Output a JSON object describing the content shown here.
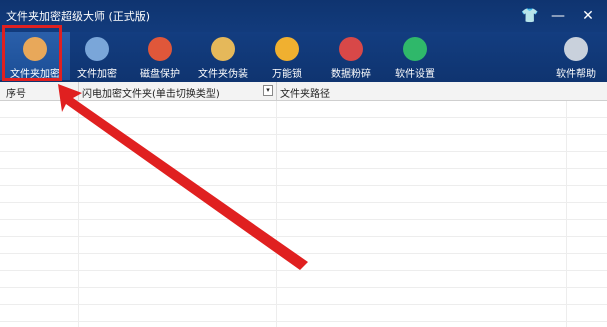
{
  "window": {
    "title": "文件夹加密超级大师 (正式版)"
  },
  "controls": {
    "skin": "👕",
    "minimize": "—",
    "close": "✕"
  },
  "toolbar": {
    "items": [
      {
        "label": "文件夹加密",
        "icon": "folder-lock-icon",
        "color": "#e8a85a"
      },
      {
        "label": "文件加密",
        "icon": "file-clipboard-icon",
        "color": "#7aa6d9"
      },
      {
        "label": "磁盘保护",
        "icon": "shield-icon",
        "color": "#e0573a"
      },
      {
        "label": "文件夹伪装",
        "icon": "palette-icon",
        "color": "#e5b85a"
      },
      {
        "label": "万能锁",
        "icon": "padlock-icon",
        "color": "#f0b030"
      },
      {
        "label": "数据粉碎",
        "icon": "scissors-icon",
        "color": "#d84848"
      },
      {
        "label": "软件设置",
        "icon": "gear-icon",
        "color": "#2fb86a"
      },
      {
        "label": "软件帮助",
        "icon": "user-help-icon",
        "color": "#c9d1dc"
      }
    ]
  },
  "table": {
    "columns": [
      "序号",
      "闪电加密文件夹(单击切换类型)",
      "文件夹路径"
    ],
    "dropdown_glyph": "▾",
    "rows": []
  },
  "annotation": {
    "arrow_color": "#e02020"
  }
}
